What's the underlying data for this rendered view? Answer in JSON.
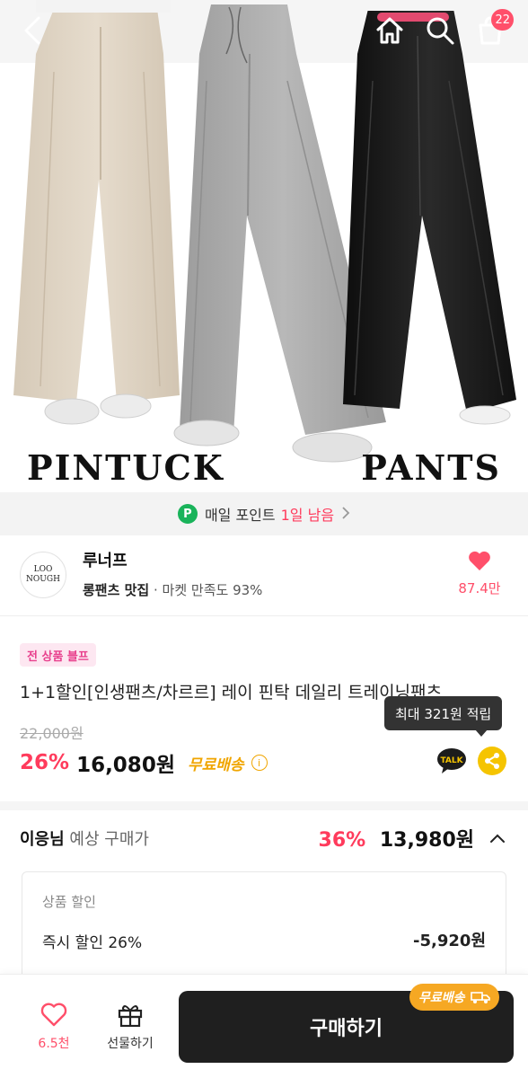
{
  "hero": {
    "word_left": "PINTUCK",
    "word_right": "PANTS"
  },
  "topbar": {
    "back_icon": "chevron-left-icon",
    "home_icon": "home-icon",
    "search_icon": "search-icon",
    "cart_icon": "shopping-bag-icon",
    "cart_count": "22"
  },
  "points": {
    "icon_letter": "P",
    "label": "매일 포인트",
    "remaining": "1일 남음"
  },
  "shop": {
    "logo_line1": "LOO",
    "logo_line2": "NOUGH",
    "name": "루너프",
    "tagline": "롱팬츠 맛집",
    "satisfaction": "· 마켓 만족도 93%",
    "like_count": "87.4만"
  },
  "product": {
    "badge": "전 상품 블프",
    "title": "1+1할인[인생팬츠/차르르] 레이 핀탁 데일리 트레이닝팬츠",
    "original_price": "22,000원",
    "discount": "26%",
    "price": "16,080원",
    "shipping": "무료배송",
    "tooltip": "최대 321원 적립",
    "talk_label": "TALK"
  },
  "expected": {
    "user": "이응님",
    "label": "예상 구매가",
    "discount": "36%",
    "price": "13,980원",
    "box_title": "상품 할인",
    "item_label": "즉시 할인 26%",
    "item_amount": "-5,920원"
  },
  "bottom": {
    "wish_count": "6.5천",
    "gift_label": "선물하기",
    "buy_label": "구매하기",
    "ship_tag": "무료배송"
  },
  "colors": {
    "accent_pink": "#ff3b5c",
    "shipping_yellow": "#f0a500",
    "points_green": "#19b35a",
    "buy_button": "#1f1f1f"
  }
}
